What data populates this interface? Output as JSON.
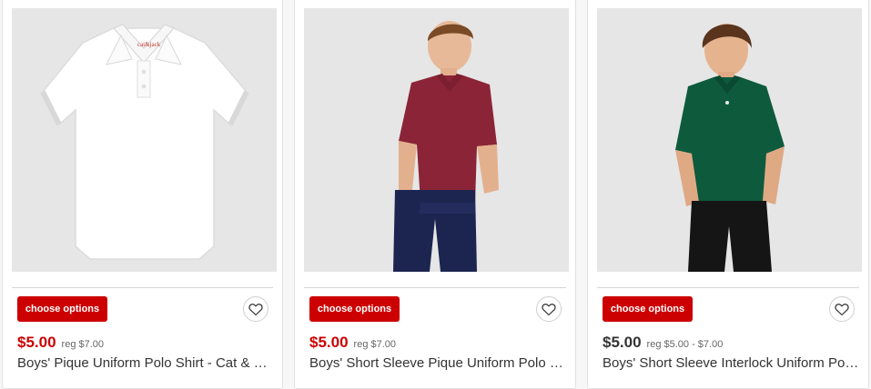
{
  "products": [
    {
      "button_label": "choose options",
      "price": "$5.00",
      "regular_price": "reg $7.00",
      "title": "Boys' Pique Uniform Polo Shirt - Cat & Jack™ White",
      "shirt_color": "#ffffff",
      "price_color": "#cc0000"
    },
    {
      "button_label": "choose options",
      "price": "$5.00",
      "regular_price": "reg $7.00",
      "title": "Boys' Short Sleeve Pique Uniform Polo Shirt - Cat & Jack™ Burgundy",
      "shirt_color": "#8b2437",
      "price_color": "#cc0000"
    },
    {
      "button_label": "choose options",
      "price": "$5.00",
      "regular_price": "reg $5.00 - $7.00",
      "title": "Boys' Short Sleeve Interlock Uniform Polo Shirt - Cat & Jack™ Green",
      "shirt_color": "#0e5a3d",
      "price_color": "#333333"
    }
  ],
  "brand_color": "#cc0000",
  "icons": {
    "favorite": "heart-icon"
  }
}
